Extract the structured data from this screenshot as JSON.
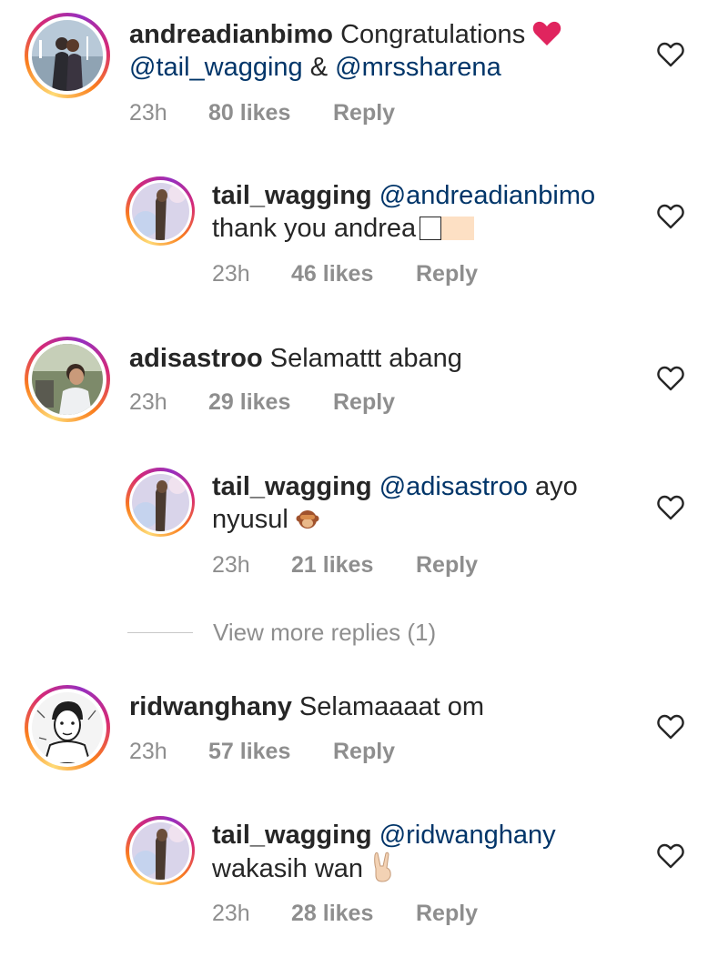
{
  "comments": [
    {
      "username": "andreadianbimo",
      "text": "Congratulations",
      "mention1": "@tail_wagging",
      "joiner": " & ",
      "mention2": "@mrssharena",
      "time": "23h",
      "likes": "80 likes",
      "reply_label": "Reply"
    },
    {
      "username": "tail_wagging",
      "mention": "@andreadianbimo",
      "text": "thank you andrea",
      "time": "23h",
      "likes": "46 likes",
      "reply_label": "Reply"
    },
    {
      "username": "adisastroo",
      "text": "Selamattt abang",
      "time": "23h",
      "likes": "29 likes",
      "reply_label": "Reply"
    },
    {
      "username": "tail_wagging",
      "mention": "@adisastroo",
      "text_after": "ayo",
      "text_line2": "nyusul",
      "time": "23h",
      "likes": "21 likes",
      "reply_label": "Reply"
    },
    {
      "username": "ridwanghany",
      "text": "Selamaaaat om",
      "time": "23h",
      "likes": "57 likes",
      "reply_label": "Reply"
    },
    {
      "username": "tail_wagging",
      "mention": "@ridwanghany",
      "text": "wakasih wan",
      "time": "23h",
      "likes": "28 likes",
      "reply_label": "Reply"
    }
  ],
  "view_more_replies": "View more replies (1)",
  "colors": {
    "mention": "#003569",
    "meta": "#8e8e8e",
    "text": "#262626",
    "emoji_heart": "#e0245e"
  },
  "icons": [
    "heart-outline-icon",
    "red-heart-emoji",
    "see-no-evil-monkey-emoji",
    "victory-hand-emoji"
  ]
}
